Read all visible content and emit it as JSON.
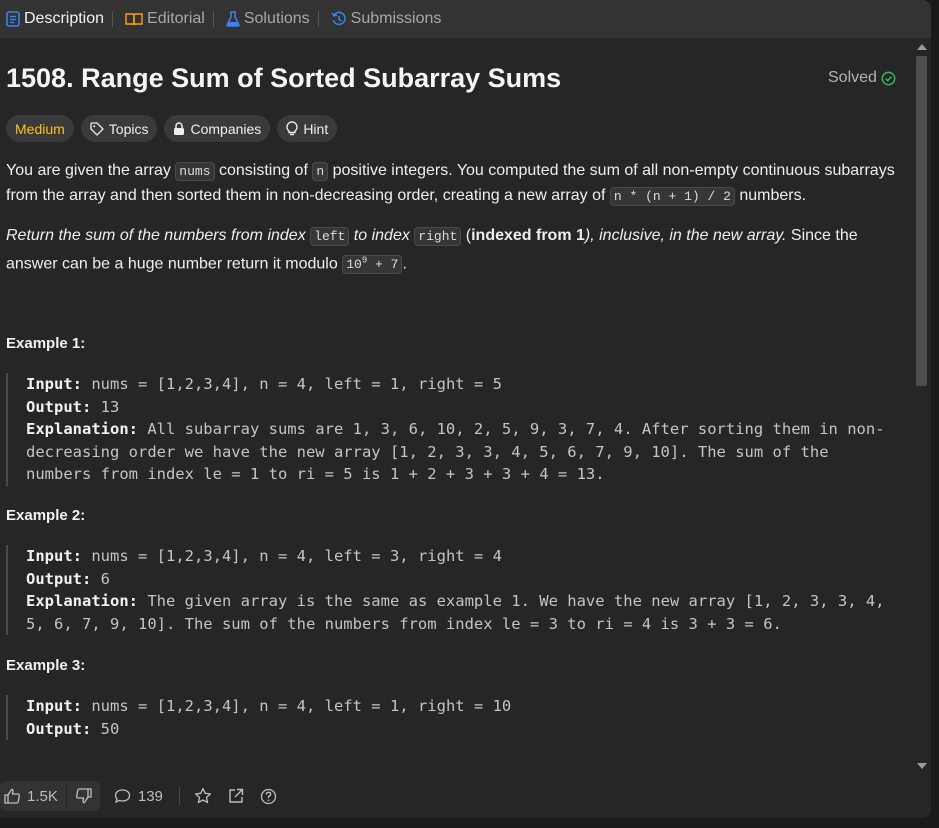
{
  "tabs": [
    {
      "label": "Description",
      "icon": "description-icon",
      "active": true
    },
    {
      "label": "Editorial",
      "icon": "book-icon",
      "active": false
    },
    {
      "label": "Solutions",
      "icon": "flask-icon",
      "active": false
    },
    {
      "label": "Submissions",
      "icon": "history-icon",
      "active": false
    }
  ],
  "problem": {
    "title": "1508. Range Sum of Sorted Subarray Sums",
    "status": "Solved",
    "difficulty": "Medium",
    "tags": [
      "Topics",
      "Companies",
      "Hint"
    ]
  },
  "description": {
    "p1_a": "You are given the array ",
    "p1_code1": "nums",
    "p1_b": " consisting of ",
    "p1_code2": "n",
    "p1_c": " positive integers. You computed the sum of all non-empty continuous subarrays from the array and then sorted them in non-decreasing order, creating a new array of ",
    "p1_code3": "n * (n + 1) / 2",
    "p1_d": " numbers.",
    "p2_a": "Return the sum of the numbers from index ",
    "p2_code1": "left",
    "p2_b": " to index ",
    "p2_code2": "right",
    "p2_c": " (",
    "p2_bold": "indexed from 1",
    "p2_d": "), inclusive, in the new array.",
    "p2_e": " Since the answer can be a huge number return it modulo ",
    "p2_mod_base": "10",
    "p2_mod_exp": "9",
    "p2_mod_rest": " + 7",
    "p2_f": "."
  },
  "examples": [
    {
      "title": "Example 1:",
      "input_label": "Input:",
      "input": " nums = [1,2,3,4], n = 4, left = 1, right = 5",
      "output_label": "Output:",
      "output": " 13",
      "explanation_label": "Explanation:",
      "explanation": " All subarray sums are 1, 3, 6, 10, 2, 5, 9, 3, 7, 4. After sorting them in non-decreasing order we have the new array [1, 2, 3, 3, 4, 5, 6, 7, 9, 10]. The sum of the numbers from index le = 1 to ri = 5 is 1 + 2 + 3 + 3 + 4 = 13."
    },
    {
      "title": "Example 2:",
      "input_label": "Input:",
      "input": " nums = [1,2,3,4], n = 4, left = 3, right = 4",
      "output_label": "Output:",
      "output": " 6",
      "explanation_label": "Explanation:",
      "explanation": " The given array is the same as example 1. We have the new array [1, 2, 3, 3, 4, 5, 6, 7, 9, 10]. The sum of the numbers from index le = 3 to ri = 4 is 3 + 3 = 6."
    },
    {
      "title": "Example 3:",
      "input_label": "Input:",
      "input": " nums = [1,2,3,4], n = 4, left = 1, right = 10",
      "output_label": "Output:",
      "output": " 50"
    }
  ],
  "footer": {
    "likes": "1.5K",
    "comments": "139"
  },
  "colors": {
    "medium": "#ffc01e",
    "solved": "#2cbb5d",
    "accent_blue": "#3b82f6"
  }
}
